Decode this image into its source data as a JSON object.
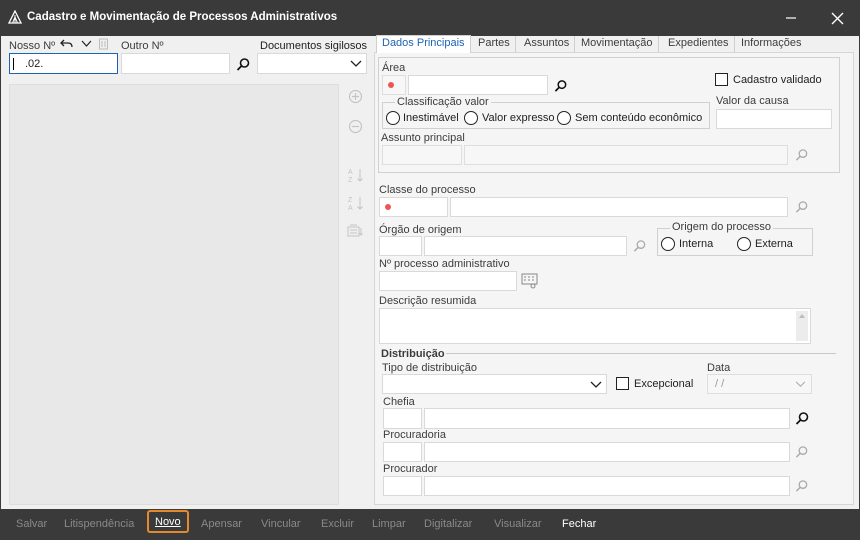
{
  "window": {
    "title": "Cadastro e Movimentação de Processos Administrativos"
  },
  "top": {
    "nosso_label": "Nosso Nº",
    "nosso_value": ".02.",
    "outro_label": "Outro Nº",
    "docs_label": "Documentos sigilosos"
  },
  "tabs": [
    "Dados Principais",
    "Partes",
    "Assuntos",
    "Movimentação",
    "Expedientes",
    "Informações"
  ],
  "form": {
    "area_label": "Área",
    "cadastro_validado": "Cadastro validado",
    "classificacao_label": "Classificação valor",
    "inestimavel": "Inestimável",
    "valor_expresso": "Valor expresso",
    "sem_conteudo": "Sem conteúdo econômico",
    "valor_causa_label": "Valor da causa",
    "assunto_label": "Assunto principal",
    "classe_label": "Classe do processo",
    "orgao_label": "Órgão de origem",
    "origem_label": "Origem do processo",
    "interna": "Interna",
    "externa": "Externa",
    "num_proc_label": "Nº processo administrativo",
    "descricao_label": "Descrição resumida",
    "distribuicao_label": "Distribuição",
    "tipo_dist_label": "Tipo de distribuição",
    "excepcional": "Excepcional",
    "data_label": "Data",
    "data_placeholder": "/ /",
    "chefia_label": "Chefia",
    "procuradoria_label": "Procuradoria",
    "procurador_label": "Procurador"
  },
  "bottom": {
    "salvar": "Salvar",
    "litispendencia": "Litispendência",
    "novo": "Novo",
    "apensar": "Apensar",
    "vincular": "Vincular",
    "excluir": "Excluir",
    "limpar": "Limpar",
    "digitalizar": "Digitalizar",
    "visualizar": "Visualizar",
    "fechar": "Fechar"
  },
  "colors": {
    "accent": "#1e62b4",
    "highlight": "#e58a2c",
    "required": "#e55555",
    "titlebar": "#3a3a3a"
  }
}
